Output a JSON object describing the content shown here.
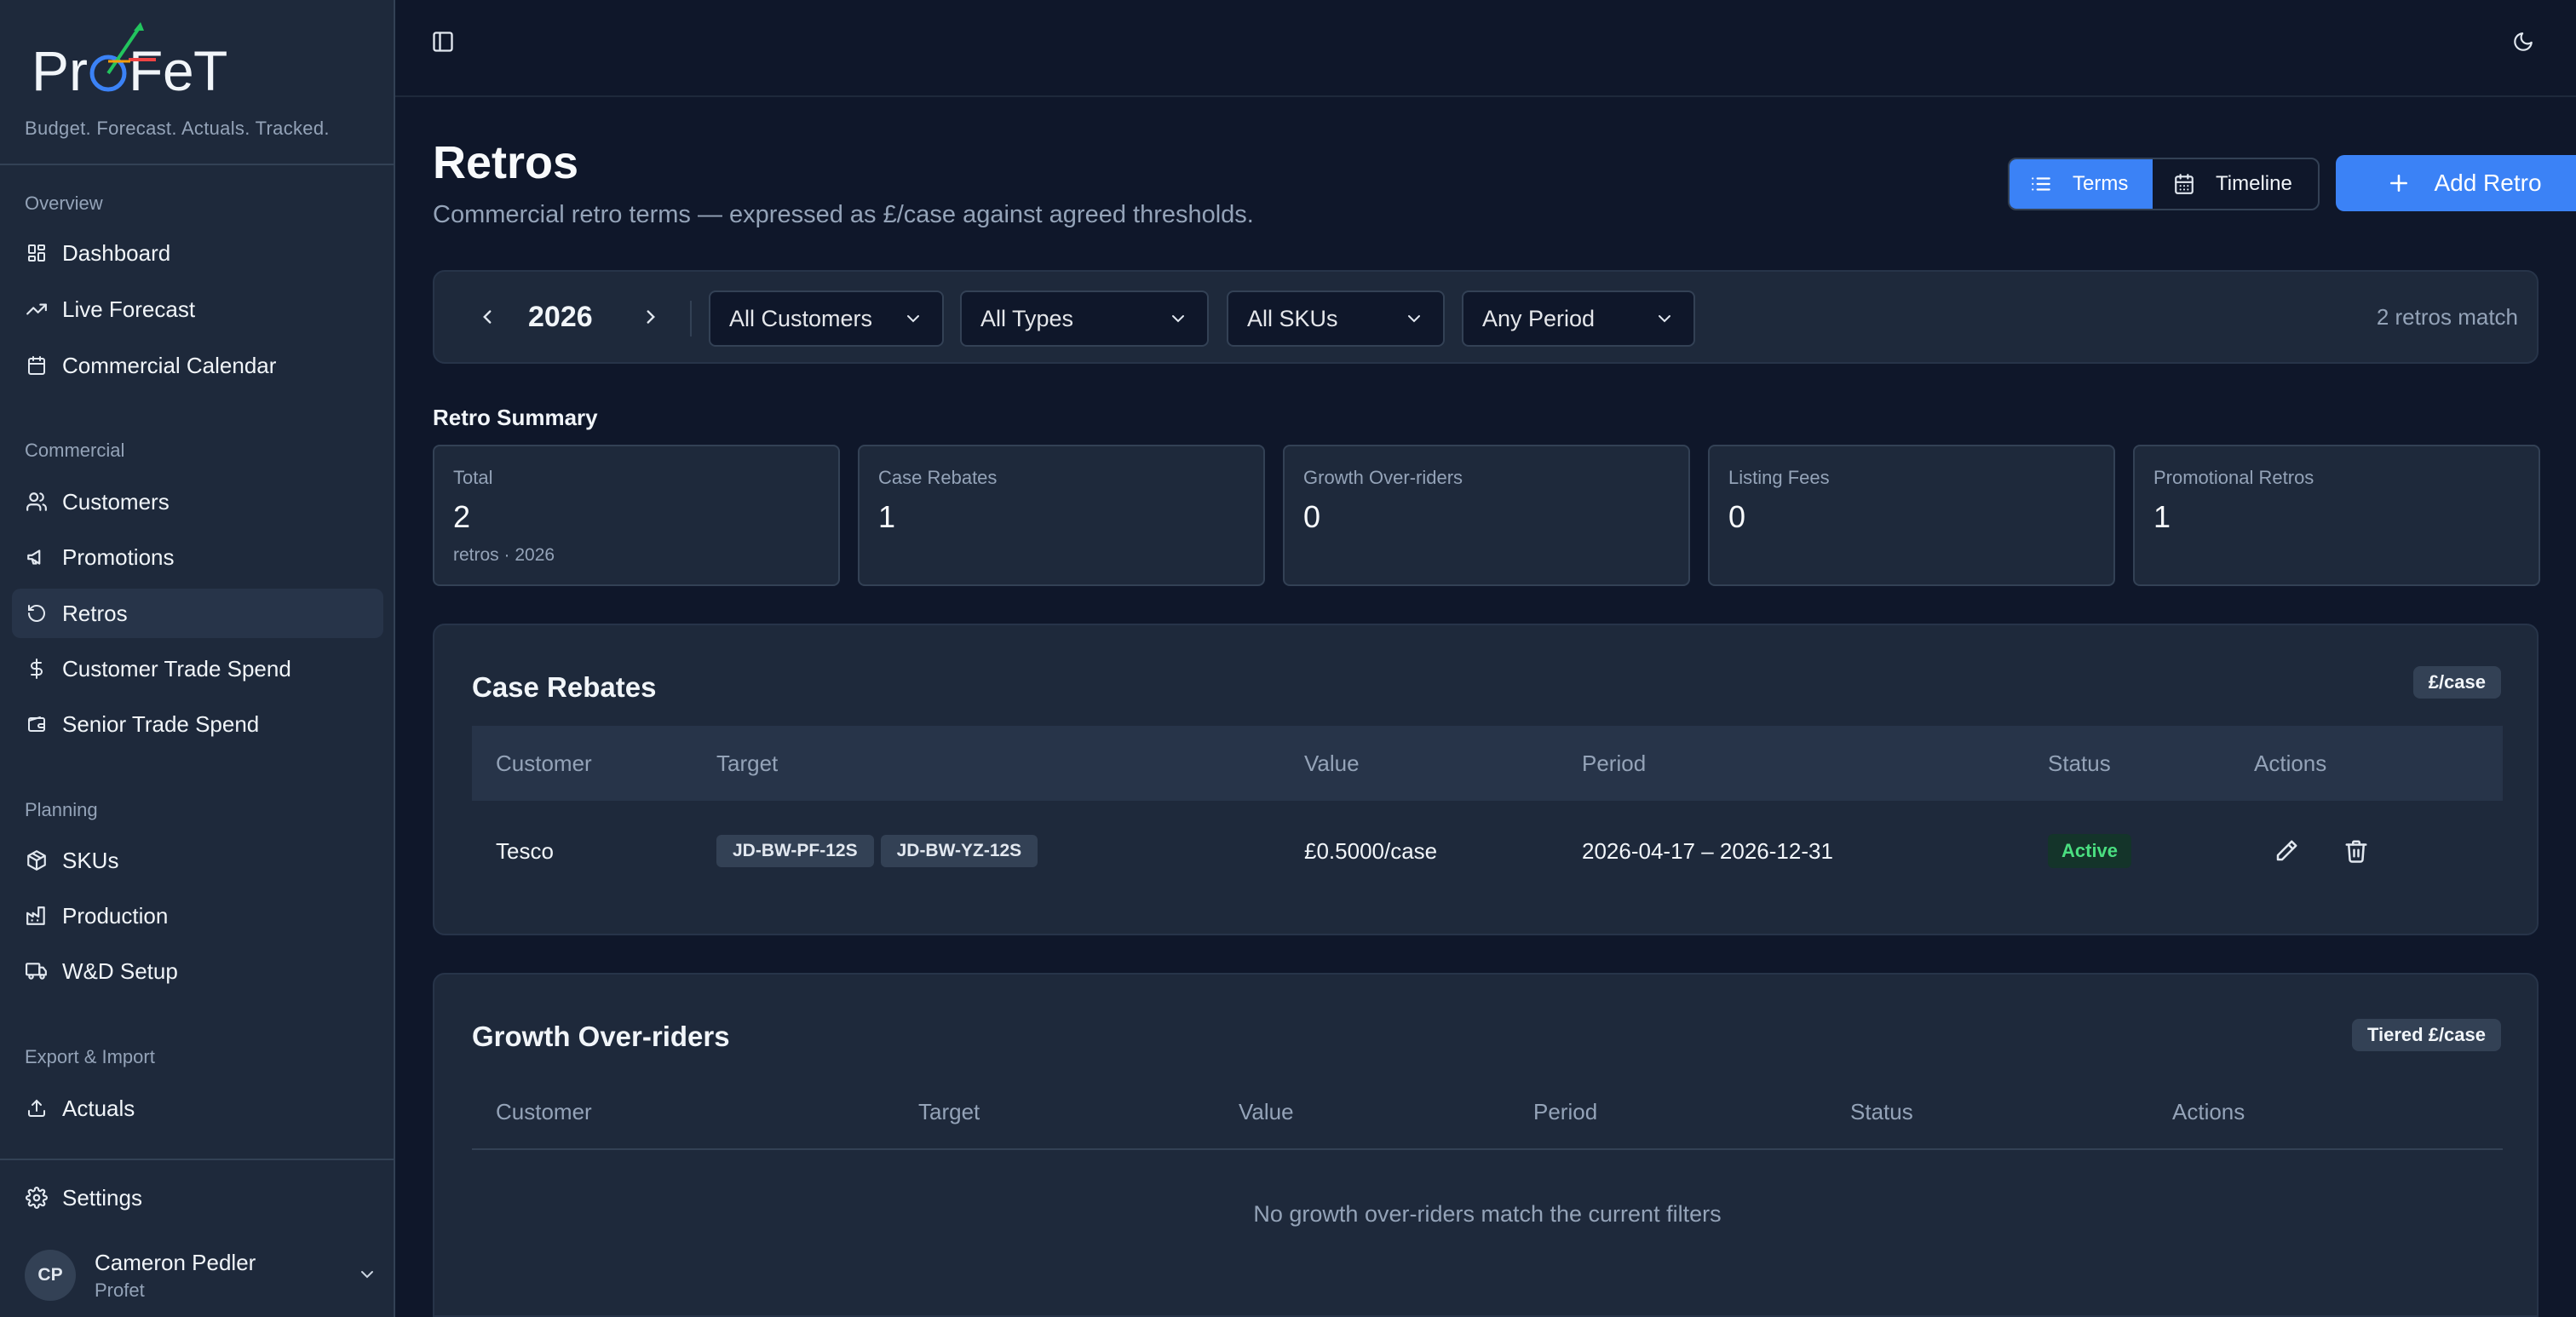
{
  "brand": {
    "name": "ProFeT",
    "tagline": "Budget. Forecast. Actuals. Tracked."
  },
  "sidebar": {
    "sections": [
      {
        "label": "Overview",
        "items": [
          {
            "label": "Dashboard",
            "icon": "grid-icon"
          },
          {
            "label": "Live Forecast",
            "icon": "trending-up-icon"
          },
          {
            "label": "Commercial Calendar",
            "icon": "calendar-icon"
          }
        ]
      },
      {
        "label": "Commercial",
        "items": [
          {
            "label": "Customers",
            "icon": "users-icon"
          },
          {
            "label": "Promotions",
            "icon": "megaphone-icon"
          },
          {
            "label": "Retros",
            "icon": "rotate-ccw-icon",
            "active": true
          },
          {
            "label": "Customer Trade Spend",
            "icon": "dollar-icon"
          },
          {
            "label": "Senior Trade Spend",
            "icon": "wallet-icon"
          }
        ]
      },
      {
        "label": "Planning",
        "items": [
          {
            "label": "SKUs",
            "icon": "box-icon"
          },
          {
            "label": "Production",
            "icon": "factory-icon"
          },
          {
            "label": "W&D Setup",
            "icon": "truck-icon"
          }
        ]
      },
      {
        "label": "Export & Import",
        "items": [
          {
            "label": "Actuals",
            "icon": "upload-icon"
          }
        ]
      }
    ],
    "settings_label": "Settings",
    "user": {
      "initials": "CP",
      "name": "Cameron Pedler",
      "org": "Profet"
    }
  },
  "page": {
    "title": "Retros",
    "subtitle": "Commercial retro terms — expressed as £/case against agreed thresholds.",
    "view_toggle": {
      "terms_label": "Terms",
      "timeline_label": "Timeline",
      "selected": "Terms"
    },
    "add_button_label": "Add Retro"
  },
  "filters": {
    "year": "2026",
    "customer": "All Customers",
    "type": "All Types",
    "sku": "All SKUs",
    "period": "Any Period",
    "match_text": "2 retros match"
  },
  "summary": {
    "title": "Retro Summary",
    "cards": [
      {
        "label": "Total",
        "value": "2",
        "sub": "retros · 2026"
      },
      {
        "label": "Case Rebates",
        "value": "1"
      },
      {
        "label": "Growth Over-riders",
        "value": "0"
      },
      {
        "label": "Listing Fees",
        "value": "0"
      },
      {
        "label": "Promotional Retros",
        "value": "1"
      }
    ]
  },
  "case_rebates": {
    "title": "Case Rebates",
    "unit_badge": "£/case",
    "columns": [
      "Customer",
      "Target",
      "Value",
      "Period",
      "Status",
      "Actions"
    ],
    "rows": [
      {
        "customer": "Tesco",
        "targets": [
          "JD-BW-PF-12S",
          "JD-BW-YZ-12S"
        ],
        "value": "£0.5000/case",
        "period": "2026-04-17 – 2026-12-31",
        "status": "Active",
        "status_color": "#4ade80"
      }
    ]
  },
  "growth_overriders": {
    "title": "Growth Over-riders",
    "unit_badge": "Tiered £/case",
    "columns": [
      "Customer",
      "Target",
      "Value",
      "Period",
      "Status",
      "Actions"
    ],
    "empty_text": "No growth over-riders match the current filters"
  },
  "theme": {
    "accent": "#3b82f6",
    "background": "#0f172a",
    "panel": "#1e293b"
  }
}
